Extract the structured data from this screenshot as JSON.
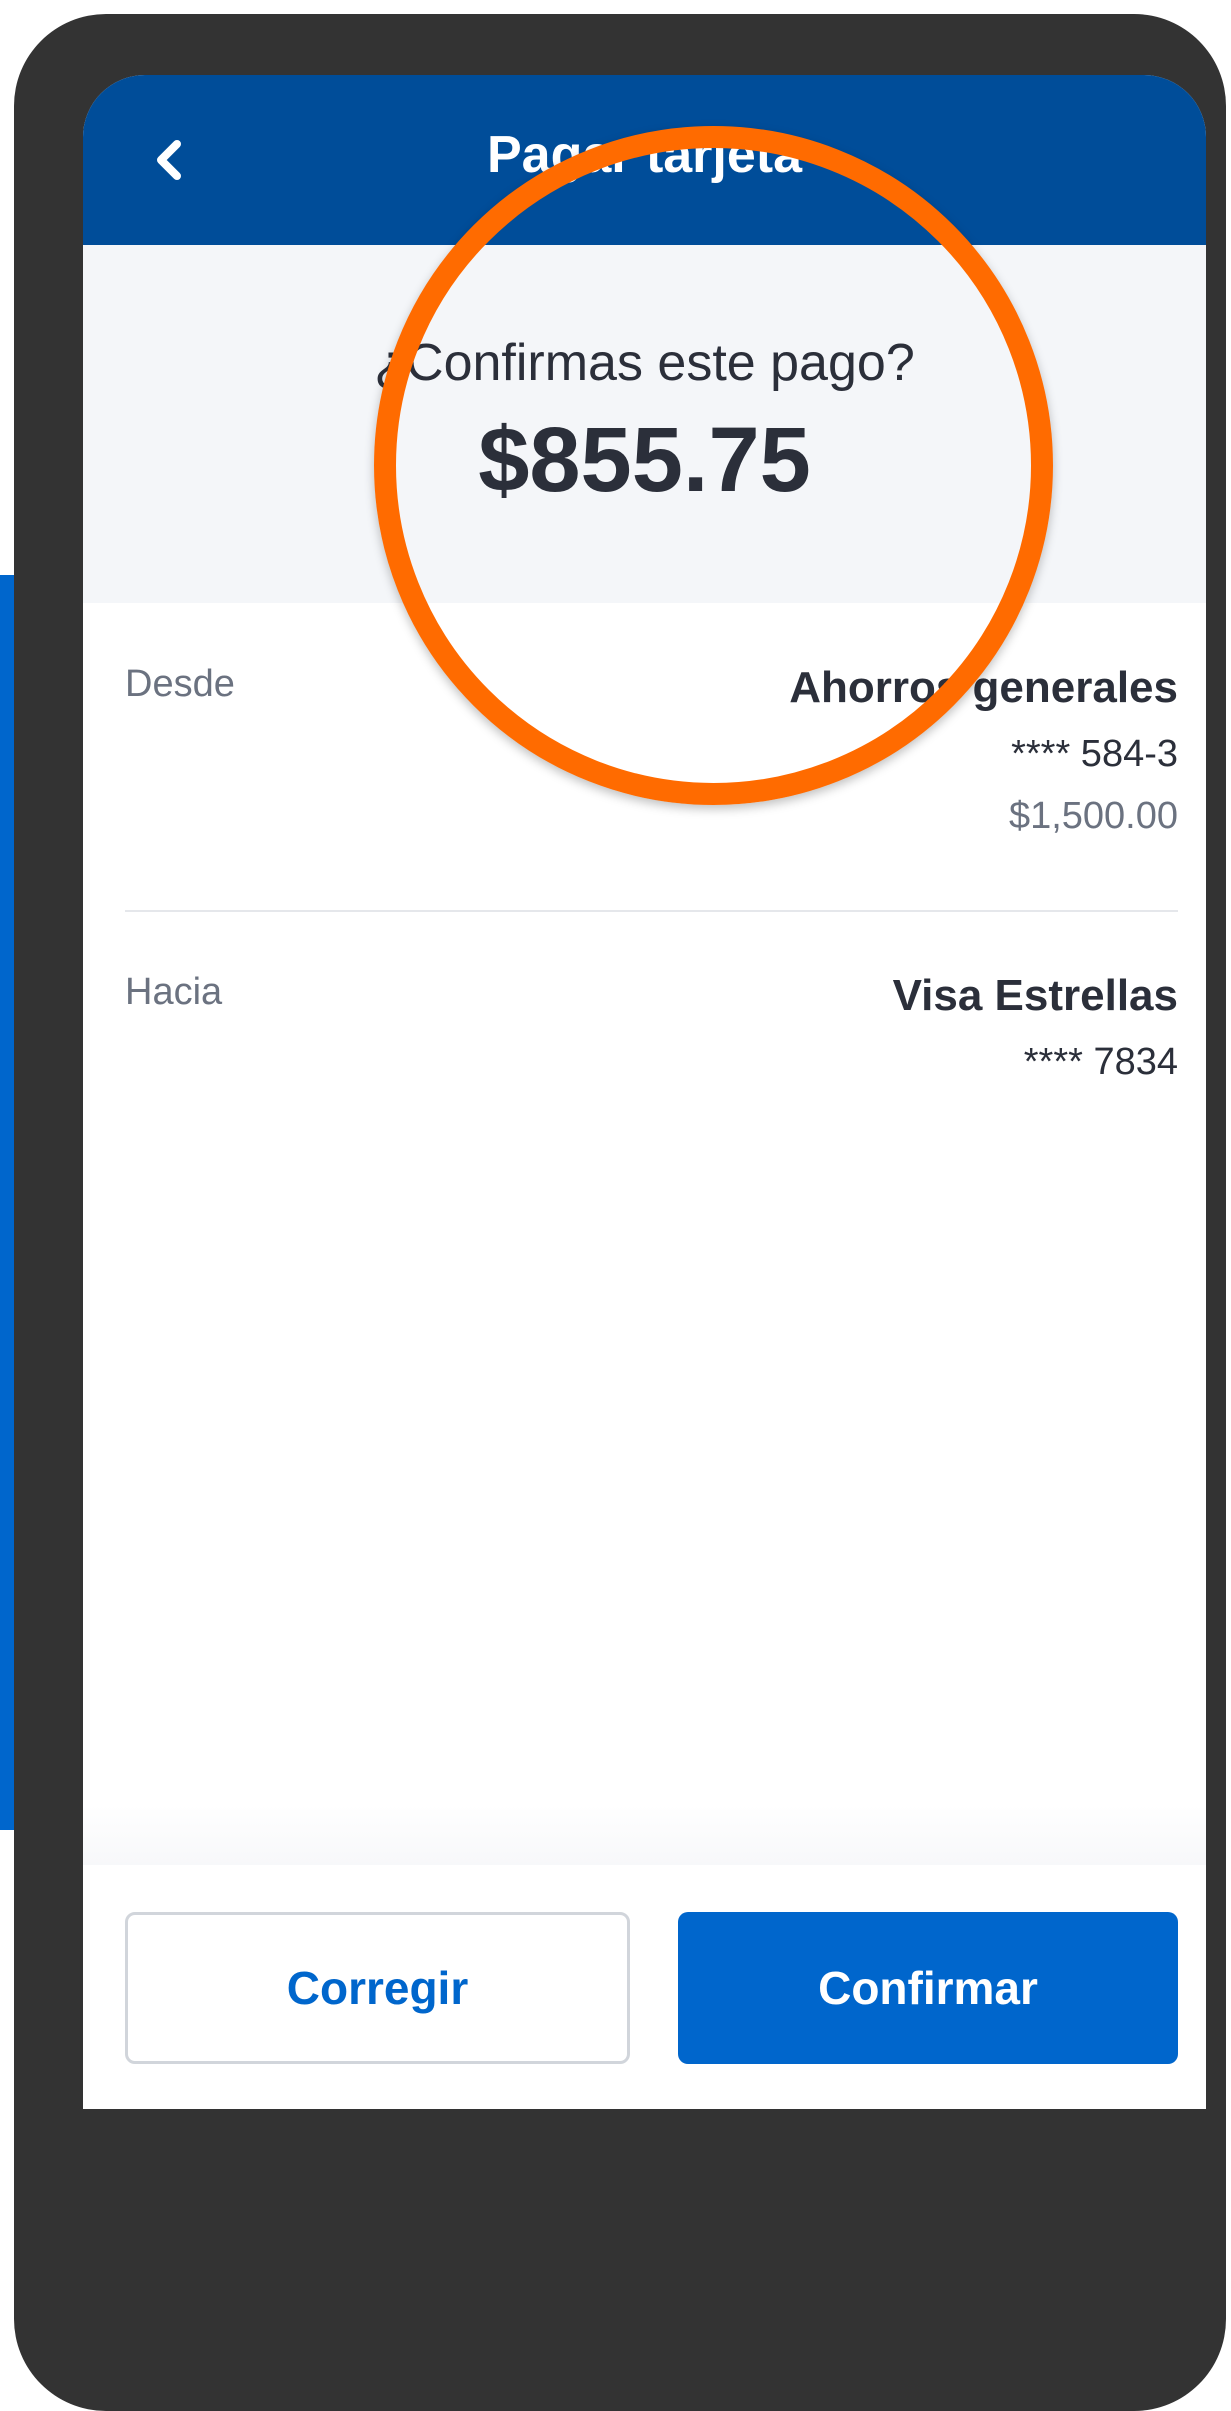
{
  "header": {
    "title": "Pagar tarjeta",
    "back_icon": "chevron-left-icon"
  },
  "summary": {
    "question": "¿Confirmas este pago?",
    "amount": "$855.75"
  },
  "from": {
    "label": "Desde",
    "account_name": "Ahorros generales",
    "account_number": "**** 584-3",
    "balance": "$1,500.00"
  },
  "to": {
    "label": "Hacia",
    "account_name": "Visa Estrellas",
    "account_number": "**** 7834"
  },
  "actions": {
    "correct_label": "Corregir",
    "confirm_label": "Confirmar"
  },
  "colors": {
    "header_blue": "#004d99",
    "primary_blue": "#0066cc",
    "highlight_orange": "#ff6b00",
    "device_frame": "#333333"
  }
}
